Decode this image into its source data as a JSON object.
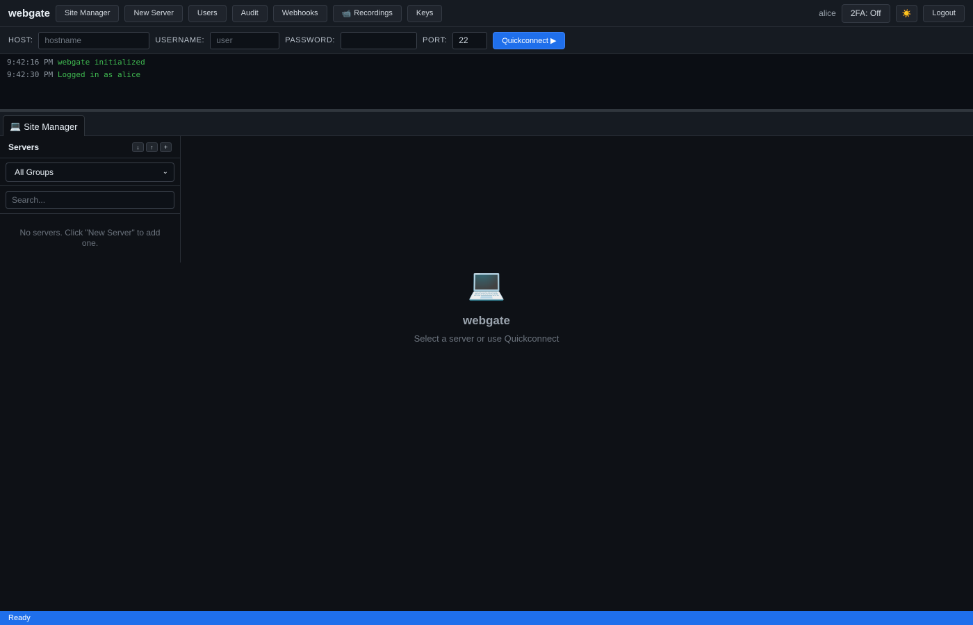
{
  "app": {
    "brand": "webgate"
  },
  "nav": {
    "site_manager": "Site Manager",
    "new_server": "New Server",
    "users": "Users",
    "audit": "Audit",
    "webhooks": "Webhooks",
    "recordings": "Recordings",
    "recordings_icon": "📹",
    "keys": "Keys",
    "username": "alice",
    "two_fa": "2FA: Off",
    "theme_icon": "☀️",
    "logout": "Logout"
  },
  "quickconnect": {
    "host_label": "HOST:",
    "host_placeholder": "hostname",
    "host_value": "",
    "username_label": "USERNAME:",
    "username_placeholder": "user",
    "username_value": "",
    "password_label": "PASSWORD:",
    "password_value": "",
    "port_label": "PORT:",
    "port_value": "22",
    "button": "Quickconnect ▶"
  },
  "log": [
    {
      "time": "9:42:16 PM",
      "message": "webgate initialized"
    },
    {
      "time": "9:42:30 PM",
      "message": "Logged in as alice"
    }
  ],
  "tabs": [
    {
      "icon": "💻",
      "label": "Site Manager"
    }
  ],
  "sidebar": {
    "title": "Servers",
    "import_icon": "↓",
    "export_icon": "↑",
    "add_icon": "+",
    "group_selected": "All Groups",
    "search_placeholder": "Search...",
    "empty_text": "No servers. Click \"New Server\" to add one."
  },
  "welcome": {
    "icon": "💻",
    "title": "webgate",
    "subtitle": "Select a server or use Quickconnect"
  },
  "status": {
    "text": "Ready"
  },
  "colors": {
    "accent": "#1f6feb",
    "background": "#0e1116",
    "log_message": "#3fb950"
  }
}
